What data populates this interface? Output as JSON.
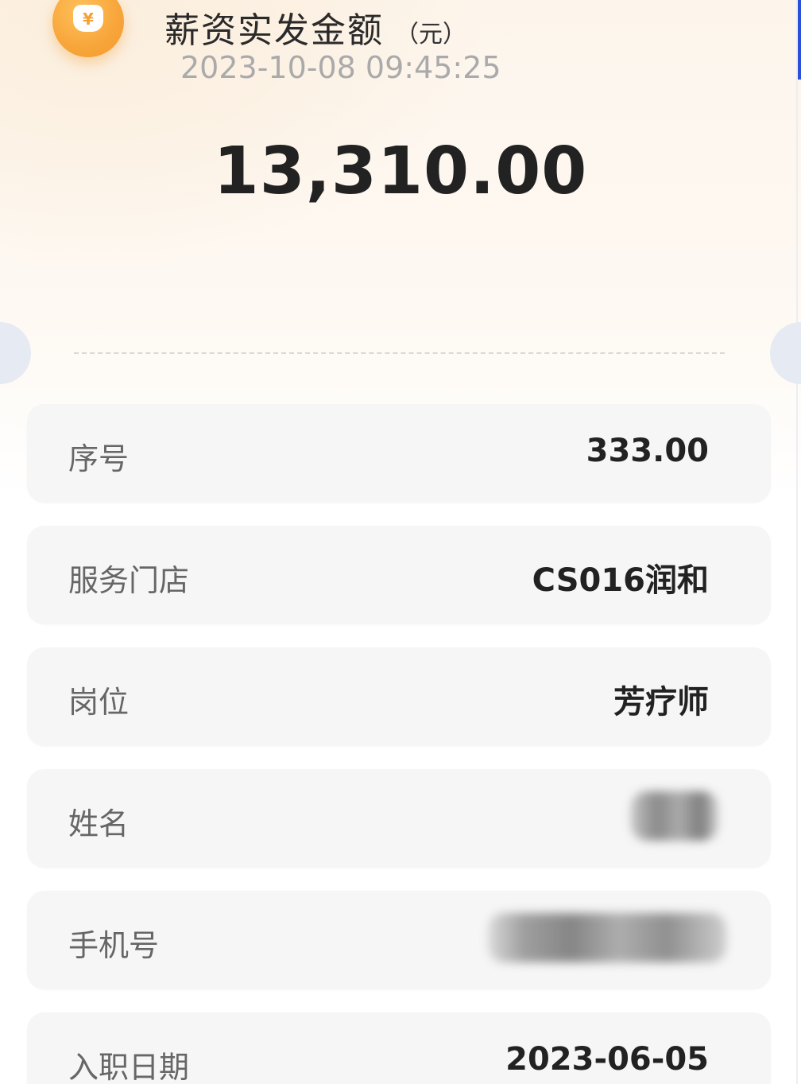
{
  "header": {
    "coin_symbol": "¥",
    "title": "薪资实发金额",
    "unit": "（元）",
    "datetime": "2023-10-08 09:45:25",
    "amount": "13,310.00",
    "accent_color": "#f7a53a"
  },
  "rows": [
    {
      "label": "序号",
      "value": "333.00"
    },
    {
      "label": "服务门店",
      "value": "CS016润和"
    },
    {
      "label": "岗位",
      "value": "芳疗师"
    },
    {
      "label": "姓名",
      "value": null
    },
    {
      "label": "手机号",
      "value": null
    },
    {
      "label": "入职日期",
      "value": "2023-06-05"
    }
  ]
}
